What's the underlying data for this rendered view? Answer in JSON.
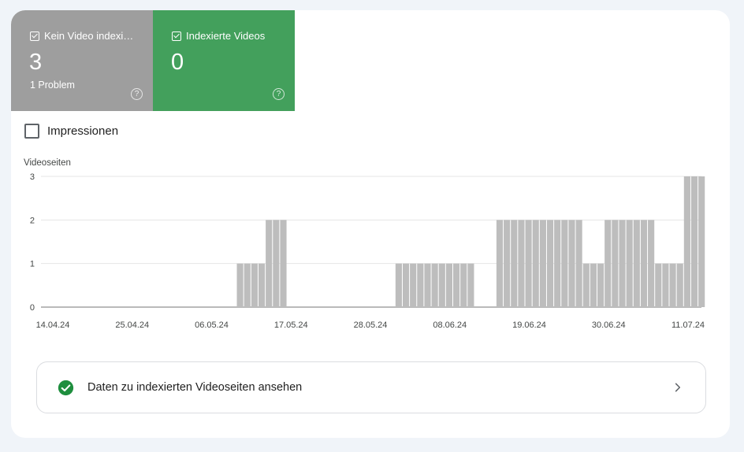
{
  "tiles": [
    {
      "checkbox": "checked",
      "label": "Kein Video indexi…",
      "value": "3",
      "sub": "1 Problem",
      "help": "?",
      "color": "#9e9e9e"
    },
    {
      "checkbox": "checked",
      "label": "Indexierte Videos",
      "value": "0",
      "sub": "",
      "help": "?",
      "color": "#43a05c"
    }
  ],
  "impressions": {
    "label": "Impressionen",
    "checked": false
  },
  "chart_data": {
    "type": "bar",
    "ylabel": "Videoseiten",
    "ylim": [
      0,
      3
    ],
    "yticks": [
      "0",
      "1",
      "2",
      "3"
    ],
    "grid": true,
    "bar_color": "#bdbdbd",
    "xtick_labels": [
      "14.04.24",
      "25.04.24",
      "06.05.24",
      "17.05.24",
      "28.05.24",
      "08.06.24",
      "19.06.24",
      "30.06.24",
      "11.07.24"
    ],
    "start_date": "14.04.24",
    "values": [
      0,
      0,
      0,
      0,
      0,
      0,
      0,
      0,
      0,
      0,
      0,
      0,
      0,
      0,
      0,
      0,
      0,
      0,
      0,
      0,
      0,
      0,
      0,
      0,
      0,
      0,
      0,
      1,
      1,
      1,
      1,
      2,
      2,
      2,
      0,
      0,
      0,
      0,
      0,
      0,
      0,
      0,
      0,
      0,
      0,
      0,
      0,
      0,
      0,
      1,
      1,
      1,
      1,
      1,
      1,
      1,
      1,
      1,
      1,
      1,
      0,
      0,
      0,
      2,
      2,
      2,
      2,
      2,
      2,
      2,
      2,
      2,
      2,
      2,
      2,
      1,
      1,
      1,
      2,
      2,
      2,
      2,
      2,
      2,
      2,
      1,
      1,
      1,
      1,
      3,
      3,
      3
    ]
  },
  "footer_link": {
    "label": "Daten zu indexierten Videoseiten ansehen",
    "status_icon": "check-circle-icon",
    "arrow_icon": "chevron-right-icon",
    "status_color": "#1e8e3e"
  }
}
